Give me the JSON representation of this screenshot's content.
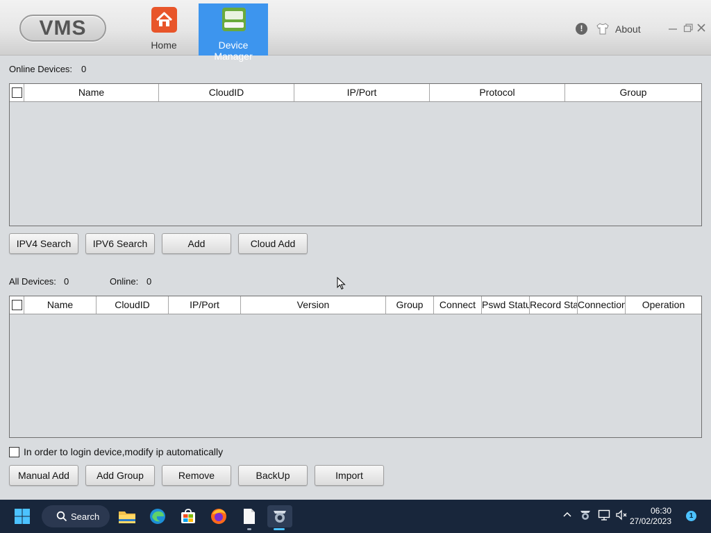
{
  "app": {
    "logo": "VMS",
    "nav": [
      {
        "label": "Home",
        "icon": "home-icon"
      },
      {
        "label": "Device Manager",
        "icon": "device-manager-icon",
        "active": true
      }
    ],
    "about_label": "About",
    "info_icon": "!",
    "window_controls": [
      "minimize",
      "restore",
      "close"
    ],
    "accent_color": "#3d95ee"
  },
  "online_section": {
    "label": "Online Devices:",
    "count": "0",
    "columns": [
      "Name",
      "CloudID",
      "IP/Port",
      "Protocol",
      "Group"
    ],
    "rows": []
  },
  "search_buttons": [
    "IPV4 Search",
    "IPV6 Search",
    "Add",
    "Cloud Add"
  ],
  "all_section": {
    "all_label": "All Devices:",
    "all_count": "0",
    "online_label": "Online:",
    "online_count": "0",
    "columns": [
      "Name",
      "CloudID",
      "IP/Port",
      "Version",
      "Group",
      "Connect",
      "Pswd Status",
      "Record Status",
      "Connections",
      "Operation"
    ],
    "rows": []
  },
  "auto_ip": {
    "label": "In order to login device,modify ip automatically",
    "checked": false
  },
  "bottom_buttons": [
    "Manual Add",
    "Add Group",
    "Remove",
    "BackUp",
    "Import"
  ],
  "taskbar": {
    "search_label": "Search",
    "apps": [
      "file-explorer-icon",
      "edge-icon",
      "store-icon",
      "firefox-icon",
      "notepad-icon",
      "vms-app-icon"
    ],
    "time": "06:30",
    "date": "27/02/2023",
    "notifications": "1"
  }
}
